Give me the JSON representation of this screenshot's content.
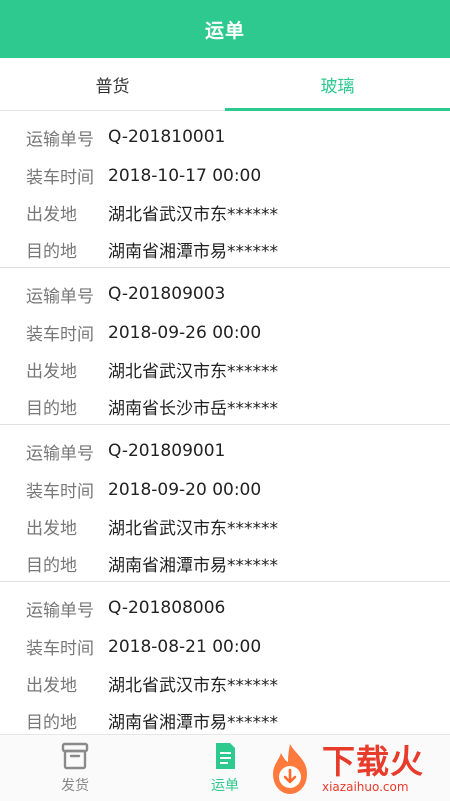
{
  "header": {
    "title": "运单"
  },
  "tabs": [
    {
      "label": "普货",
      "active": false
    },
    {
      "label": "玻璃",
      "active": true
    }
  ],
  "labels": {
    "order_no": "运输单号",
    "load_time": "装车时间",
    "origin": "出发地",
    "destination": "目的地"
  },
  "orders": [
    {
      "order_no": "Q-201810001",
      "load_time": "2018-10-17 00:00",
      "origin": "湖北省武汉市东******",
      "destination": "湖南省湘潭市易******"
    },
    {
      "order_no": "Q-201809003",
      "load_time": "2018-09-26 00:00",
      "origin": "湖北省武汉市东******",
      "destination": "湖南省长沙市岳******"
    },
    {
      "order_no": "Q-201809001",
      "load_time": "2018-09-20 00:00",
      "origin": "湖北省武汉市东******",
      "destination": "湖南省湘潭市易******"
    },
    {
      "order_no": "Q-201808006",
      "load_time": "2018-08-21 00:00",
      "origin": "湖北省武汉市东******",
      "destination": "湖南省湘潭市易******"
    }
  ],
  "bottom_nav": [
    {
      "label": "发货",
      "icon": "shipment-box-icon",
      "active": false
    },
    {
      "label": "运单",
      "icon": "waybill-document-icon",
      "active": true
    }
  ],
  "watermark": {
    "text_cn": "下载火",
    "text_en": "xiazaihuo.com",
    "color": "#e73b2b"
  },
  "colors": {
    "accent": "#2ec98e"
  }
}
